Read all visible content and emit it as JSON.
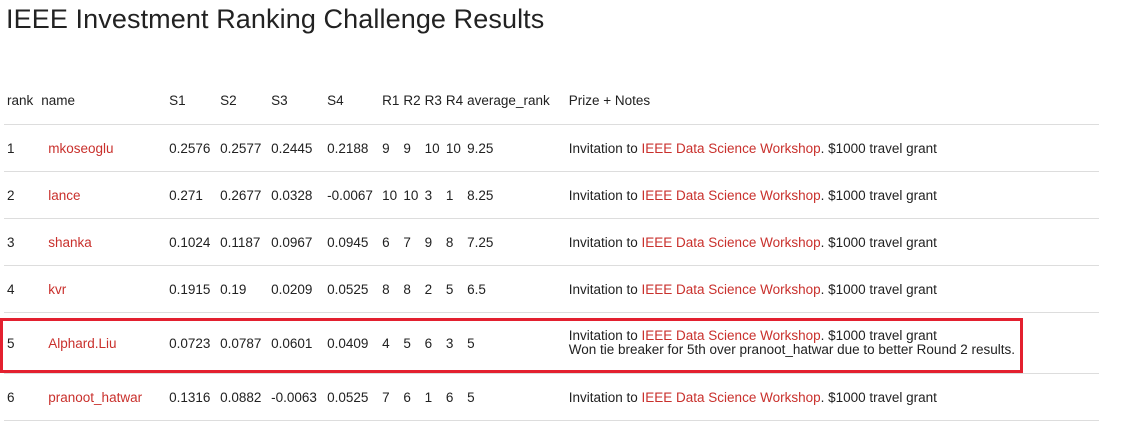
{
  "title": "IEEE Investment Ranking Challenge Results",
  "colors": {
    "link": "#c9302c",
    "highlight": "#e3202f",
    "divider": "#dddddd"
  },
  "table": {
    "headers": {
      "rank": "rank",
      "name": "name",
      "s1": "S1",
      "s2": "S2",
      "s3": "S3",
      "s4": "S4",
      "r1": "R1",
      "r2": "R2",
      "r3": "R3",
      "r4": "R4",
      "avg": "average_rank",
      "prize": "Prize + Notes"
    },
    "rows": [
      {
        "rank": "1",
        "name": "mkoseoglu",
        "s1": "0.2576",
        "s2": "0.2577",
        "s3": "0.2445",
        "s4": "0.2188",
        "r1": "9",
        "r2": "9",
        "r3": "10",
        "r4": "10",
        "avg": "9.25",
        "prize_pre": "Invitation to ",
        "prize_link": "IEEE Data Science Workshop",
        "prize_post": ". $1000 travel grant",
        "note": ""
      },
      {
        "rank": "2",
        "name": "lance",
        "s1": "0.271",
        "s2": "0.2677",
        "s3": "0.0328",
        "s4": "-0.0067",
        "r1": "10",
        "r2": "10",
        "r3": "3",
        "r4": "1",
        "avg": "8.25",
        "prize_pre": "Invitation to ",
        "prize_link": "IEEE Data Science Workshop",
        "prize_post": ". $1000 travel grant",
        "note": ""
      },
      {
        "rank": "3",
        "name": "shanka",
        "s1": "0.1024",
        "s2": "0.1187",
        "s3": "0.0967",
        "s4": "0.0945",
        "r1": "6",
        "r2": "7",
        "r3": "9",
        "r4": "8",
        "avg": "7.25",
        "prize_pre": "Invitation to ",
        "prize_link": "IEEE Data Science Workshop",
        "prize_post": ". $1000 travel grant",
        "note": ""
      },
      {
        "rank": "4",
        "name": "kvr",
        "s1": "0.1915",
        "s2": "0.19",
        "s3": "0.0209",
        "s4": "0.0525",
        "r1": "8",
        "r2": "8",
        "r3": "2",
        "r4": "5",
        "avg": "6.5",
        "prize_pre": "Invitation to ",
        "prize_link": "IEEE Data Science Workshop",
        "prize_post": ". $1000 travel grant",
        "note": ""
      },
      {
        "rank": "5",
        "name": "Alphard.Liu",
        "s1": "0.0723",
        "s2": "0.0787",
        "s3": "0.0601",
        "s4": "0.0409",
        "r1": "4",
        "r2": "5",
        "r3": "6",
        "r4": "3",
        "avg": "5",
        "prize_pre": "Invitation to ",
        "prize_link": "IEEE Data Science Workshop",
        "prize_post": ". $1000 travel grant",
        "note": "Won tie breaker for 5th over pranoot_hatwar due to better Round 2 results."
      },
      {
        "rank": "6",
        "name": "pranoot_hatwar",
        "s1": "0.1316",
        "s2": "0.0882",
        "s3": "-0.0063",
        "s4": "0.0525",
        "r1": "7",
        "r2": "6",
        "r3": "1",
        "r4": "6",
        "avg": "5",
        "prize_pre": "Invitation to ",
        "prize_link": "IEEE Data Science Workshop",
        "prize_post": ". $1000 travel grant",
        "note": ""
      }
    ]
  }
}
